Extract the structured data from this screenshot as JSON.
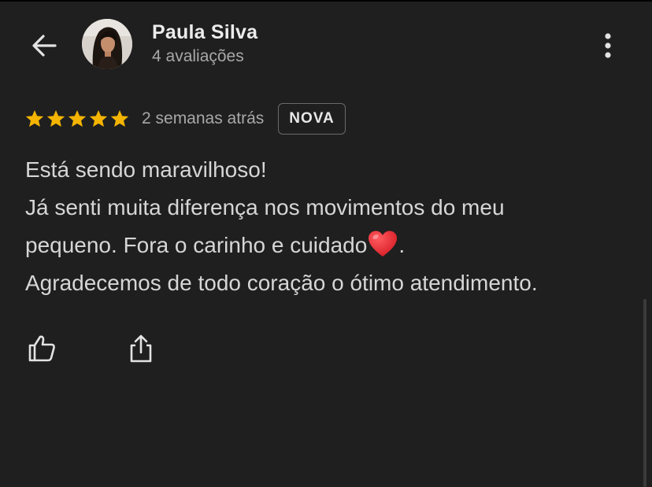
{
  "header": {
    "back_icon": "arrow-left-icon",
    "author_name": "Paula Silva",
    "author_reviews": "4 avaliações",
    "avatar_icon": "profile-photo",
    "more_icon": "more-vert-icon"
  },
  "review": {
    "rating": 5,
    "max_rating": 5,
    "star_color": "#f4b400",
    "date": "2 semanas atrás",
    "badge": "NOVA",
    "lines": [
      "Está sendo maravilhoso!",
      "Já senti muita diferença nos movimentos do meu",
      "pequeno. Fora o carinho e cuidado",
      ".",
      "Agradecemos de todo coração o ótimo atendimento."
    ],
    "emoji": "red-heart-emoji"
  },
  "actions": {
    "like_icon": "thumb-up-icon",
    "share_icon": "share-icon"
  },
  "colors": {
    "background": "#1f1f1f",
    "text": "#d6d6d6",
    "secondary_text": "#a8a8a8",
    "heart": "#e0242c"
  }
}
